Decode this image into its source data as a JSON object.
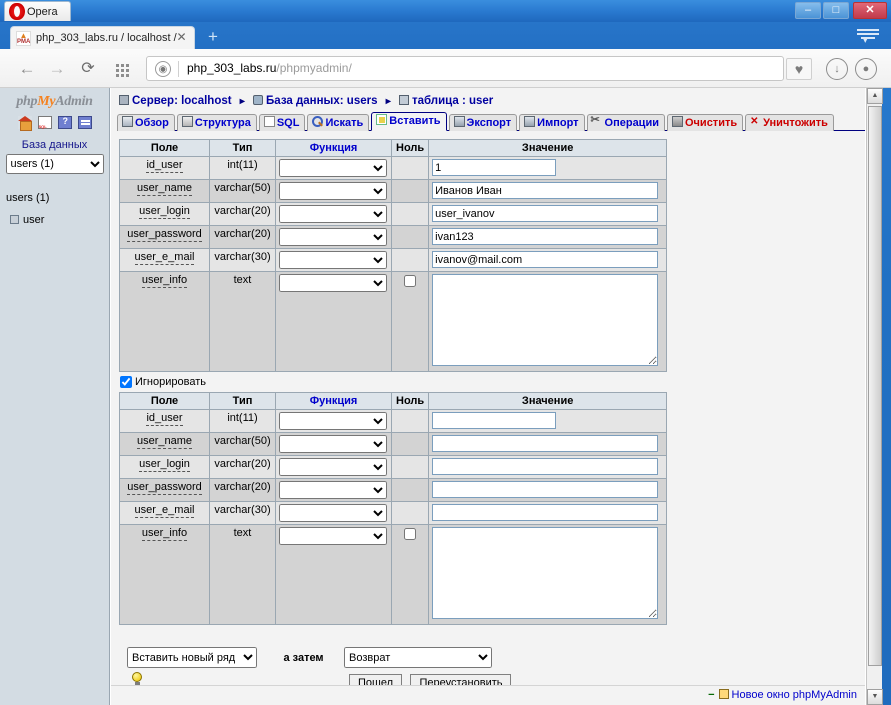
{
  "window": {
    "app_title": "Opera",
    "minimize_label": "–",
    "maximize_label": "□",
    "close_label": "✕"
  },
  "browser": {
    "tab_title": "php_303_labs.ru / localhost /",
    "tab_close": "✕",
    "new_tab": "+",
    "back_icon": "←",
    "forward_icon": "→",
    "reload_icon": "⟳",
    "url_value": "php_303_labs.ru",
    "url_path": "/phpmyadmin/",
    "heart_icon": "♥",
    "download_icon": "↓",
    "profile_icon": "●"
  },
  "sidebar": {
    "logo": {
      "part1": "php",
      "part2": "My",
      "part3": "Admin"
    },
    "icons": [
      "home-icon",
      "sql-query-icon",
      "documentation-icon",
      "phpmyadmin-docs-icon"
    ],
    "db_label": "База данных",
    "db_select_value": "users (1)",
    "db_select_options": [
      "users (1)"
    ],
    "db_name": "users (1)",
    "tables": [
      "user"
    ]
  },
  "breadcrumb": {
    "server_label": "Сервер: localhost",
    "database_label": "База данных: users",
    "table_label": "таблица : user",
    "separator": "▸"
  },
  "tabs": [
    {
      "label": "Обзор",
      "icon": "browse-icon",
      "active": false,
      "danger": false
    },
    {
      "label": "Структура",
      "icon": "structure-icon",
      "active": false,
      "danger": false
    },
    {
      "label": "SQL",
      "icon": "sql-icon",
      "active": false,
      "danger": false
    },
    {
      "label": "Искать",
      "icon": "search-icon",
      "active": false,
      "danger": false
    },
    {
      "label": "Вставить",
      "icon": "insert-icon",
      "active": true,
      "danger": false
    },
    {
      "label": "Экспорт",
      "icon": "export-icon",
      "active": false,
      "danger": false
    },
    {
      "label": "Импорт",
      "icon": "import-icon",
      "active": false,
      "danger": false
    },
    {
      "label": "Операции",
      "icon": "operations-icon",
      "active": false,
      "danger": false
    },
    {
      "label": "Очистить",
      "icon": "empty-icon",
      "active": false,
      "danger": true
    },
    {
      "label": "Уничтожить",
      "icon": "drop-icon",
      "active": false,
      "danger": true
    }
  ],
  "table_headers": {
    "field": "Поле",
    "type": "Тип",
    "function": "Функция",
    "null": "Ноль",
    "value": "Значение"
  },
  "form1": {
    "rows": [
      {
        "field": "id_user",
        "type": "int(11)",
        "function": "",
        "null": false,
        "has_null_box": false,
        "value": "1",
        "input": "small"
      },
      {
        "field": "user_name",
        "type": "varchar(50)",
        "function": "",
        "null": false,
        "has_null_box": false,
        "value": "Иванов Иван",
        "input": "full"
      },
      {
        "field": "user_login",
        "type": "varchar(20)",
        "function": "",
        "null": false,
        "has_null_box": false,
        "value": "user_ivanov",
        "input": "full"
      },
      {
        "field": "user_password",
        "type": "varchar(20)",
        "function": "",
        "null": false,
        "has_null_box": false,
        "value": "ivan123",
        "input": "full"
      },
      {
        "field": "user_e_mail",
        "type": "varchar(30)",
        "function": "",
        "null": false,
        "has_null_box": false,
        "value": "ivanov@mail.com",
        "input": "full"
      },
      {
        "field": "user_info",
        "type": "text",
        "function": "",
        "null": false,
        "has_null_box": true,
        "value": "",
        "input": "textarea"
      }
    ]
  },
  "ignore": {
    "label": "Игнорировать",
    "checked": true
  },
  "form2": {
    "rows": [
      {
        "field": "id_user",
        "type": "int(11)",
        "function": "",
        "null": false,
        "has_null_box": false,
        "value": "",
        "input": "small"
      },
      {
        "field": "user_name",
        "type": "varchar(50)",
        "function": "",
        "null": false,
        "has_null_box": false,
        "value": "",
        "input": "full"
      },
      {
        "field": "user_login",
        "type": "varchar(20)",
        "function": "",
        "null": false,
        "has_null_box": false,
        "value": "",
        "input": "full"
      },
      {
        "field": "user_password",
        "type": "varchar(20)",
        "function": "",
        "null": false,
        "has_null_box": false,
        "value": "",
        "input": "full"
      },
      {
        "field": "user_e_mail",
        "type": "varchar(30)",
        "function": "",
        "null": false,
        "has_null_box": false,
        "value": "",
        "input": "full"
      },
      {
        "field": "user_info",
        "type": "text",
        "function": "",
        "null": false,
        "has_null_box": true,
        "value": "",
        "input": "textarea"
      }
    ]
  },
  "footer": {
    "action_value": "Вставить новый ряд",
    "action_options": [
      "Вставить новый ряд"
    ],
    "and_then": "а затем",
    "after_value": "Возврат",
    "after_options": [
      "Возврат"
    ],
    "go_button": "Пошел",
    "reset_button": "Переустановить",
    "hint_icon": "lightbulb-icon"
  },
  "status": {
    "collapse_icon": "−",
    "new_window_label": "Новое окно phpMyAdmin"
  },
  "colors": {
    "chrome_blue": "#1f68bd",
    "link_blue": "#0000cc",
    "danger_red": "#cc0000",
    "header_bg": "#dde4ea",
    "row_odd": "#e5e5e5",
    "row_even": "#d3d3d3",
    "accent_orange": "#f58220"
  }
}
